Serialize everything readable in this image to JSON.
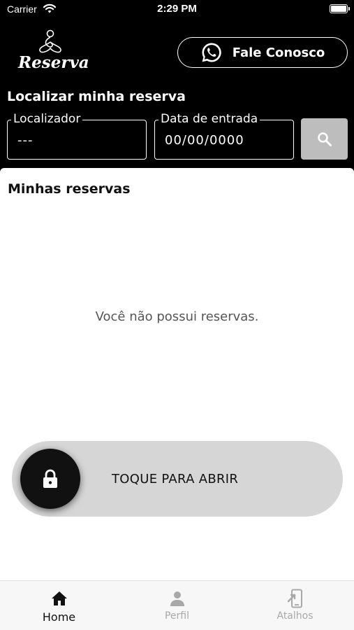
{
  "status_bar": {
    "carrier": "Carrier",
    "time": "2:29 PM"
  },
  "header": {
    "logo_text": "Reserva",
    "contact_button_label": "Fale Conosco",
    "contact_icon": "whatsapp-icon"
  },
  "search": {
    "title": "Localizar minha reserva",
    "locator_label": "Localizador",
    "locator_value": "---",
    "date_label": "Data de entrada",
    "date_value": "00/00/0000",
    "search_icon": "search-icon"
  },
  "reservations": {
    "title": "Minhas reservas",
    "empty_message": "Você não possui reservas."
  },
  "slider": {
    "label": "TOQUE PARA ABRIR",
    "icon": "lock-icon"
  },
  "tabs": [
    {
      "label": "Home",
      "icon": "home-icon",
      "active": true
    },
    {
      "label": "Perfil",
      "icon": "person-icon",
      "active": false
    },
    {
      "label": "Atalhos",
      "icon": "shortcut-icon",
      "active": false
    }
  ],
  "colors": {
    "background": "#000000",
    "panel": "#ffffff",
    "search_button": "#bdbdbd",
    "slider_track": "#d6d6d6",
    "inactive_tab": "#a8a8a8"
  }
}
